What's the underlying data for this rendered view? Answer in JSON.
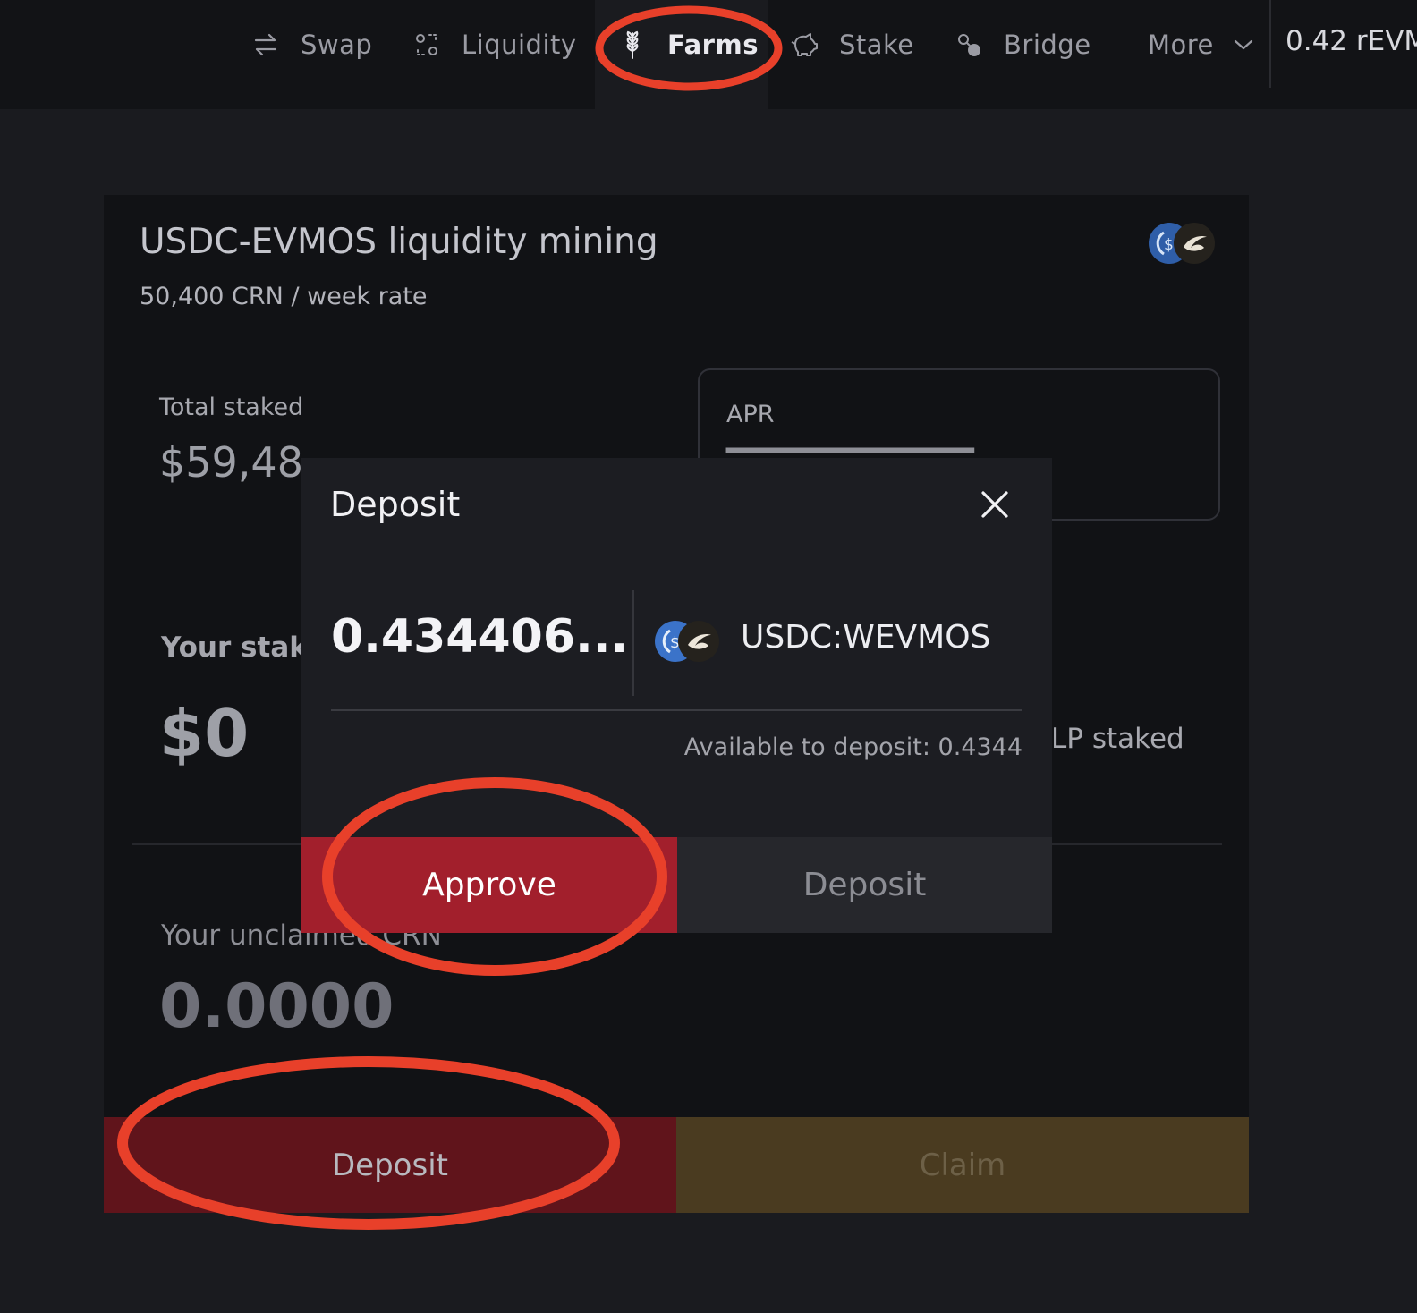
{
  "nav": {
    "items": [
      {
        "label": "Swap",
        "icon": "swap-arrows-icon"
      },
      {
        "label": "Liquidity",
        "icon": "liquidity-icon"
      },
      {
        "label": "Farms",
        "icon": "wheat-icon",
        "active": true
      },
      {
        "label": "Stake",
        "icon": "piggy-bank-icon"
      },
      {
        "label": "Bridge",
        "icon": "bridge-icon"
      },
      {
        "label": "More",
        "icon": "chevron-down-icon"
      }
    ],
    "balance": "0.42 rEVM"
  },
  "farm": {
    "title": "USDC-EVMOS liquidity mining",
    "rate": "50,400 CRN / week rate",
    "total_staked_label": "Total staked",
    "total_staked_value": "$59,48",
    "apr_label": "APR",
    "your_staked_label": "Your stak",
    "your_staked_value": "$0",
    "lp_staked_label": "LP staked",
    "unclaimed_label": "Your unclaimed CRN",
    "unclaimed_value": "0.0000",
    "deposit_label": "Deposit",
    "claim_label": "Claim"
  },
  "modal": {
    "title": "Deposit",
    "amount": "0.434406...",
    "token_name": "USDC:WEVMOS",
    "available": "Available to deposit: 0.4344",
    "approve_label": "Approve",
    "deposit_label": "Deposit"
  },
  "colors": {
    "approve": "#a21f2c",
    "card_deposit": "#60141b",
    "claim": "#4a3b20",
    "annotation": "#e8402a",
    "usdc_blue": "#2775ca"
  }
}
